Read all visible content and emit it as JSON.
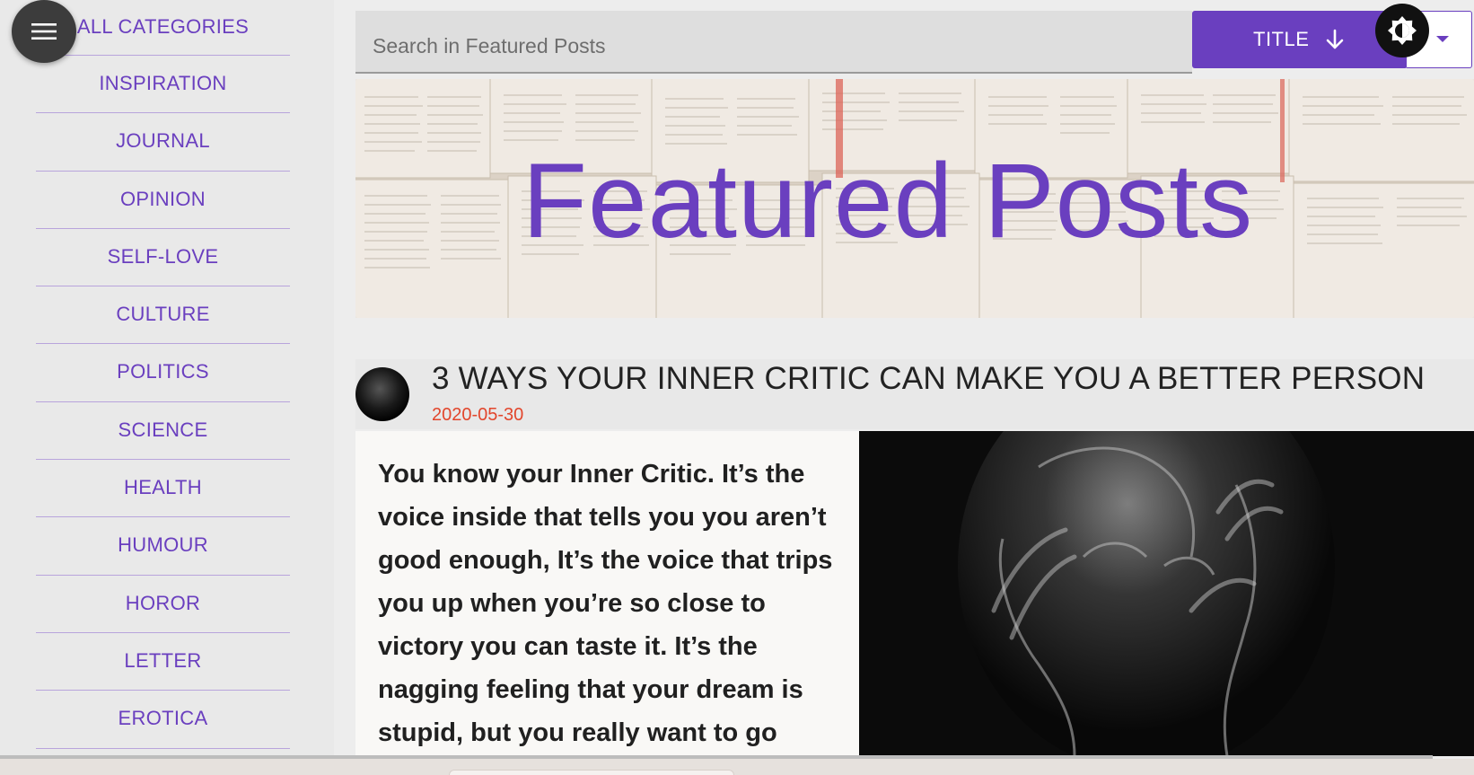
{
  "sidebar": {
    "categories": [
      "ALL CATEGORIES",
      "INSPIRATION",
      "JOURNAL",
      "OPINION",
      "SELF-LOVE",
      "CULTURE",
      "POLITICS",
      "SCIENCE",
      "HEALTH",
      "HUMOUR",
      "HOROR",
      "LETTER",
      "EROTICA"
    ]
  },
  "search": {
    "placeholder": "Search in Featured Posts"
  },
  "sort": {
    "label": "TITLE",
    "direction_icon": "arrow-down-icon"
  },
  "hero": {
    "title": "Featured Posts"
  },
  "post": {
    "title": "3 WAYS YOUR INNER CRITIC CAN MAKE YOU A BETTER PERSON",
    "date": "2020-05-30",
    "excerpt": "You know your Inner Critic. It’s the voice inside that tells you you aren’t good enough, It’s the voice that trips you up when you’re so close to victory you can taste it. It’s the nagging feeling that your dream is stupid, but you really want to go after"
  },
  "colors": {
    "accent": "#6a3fbf",
    "date": "#e2462c"
  }
}
